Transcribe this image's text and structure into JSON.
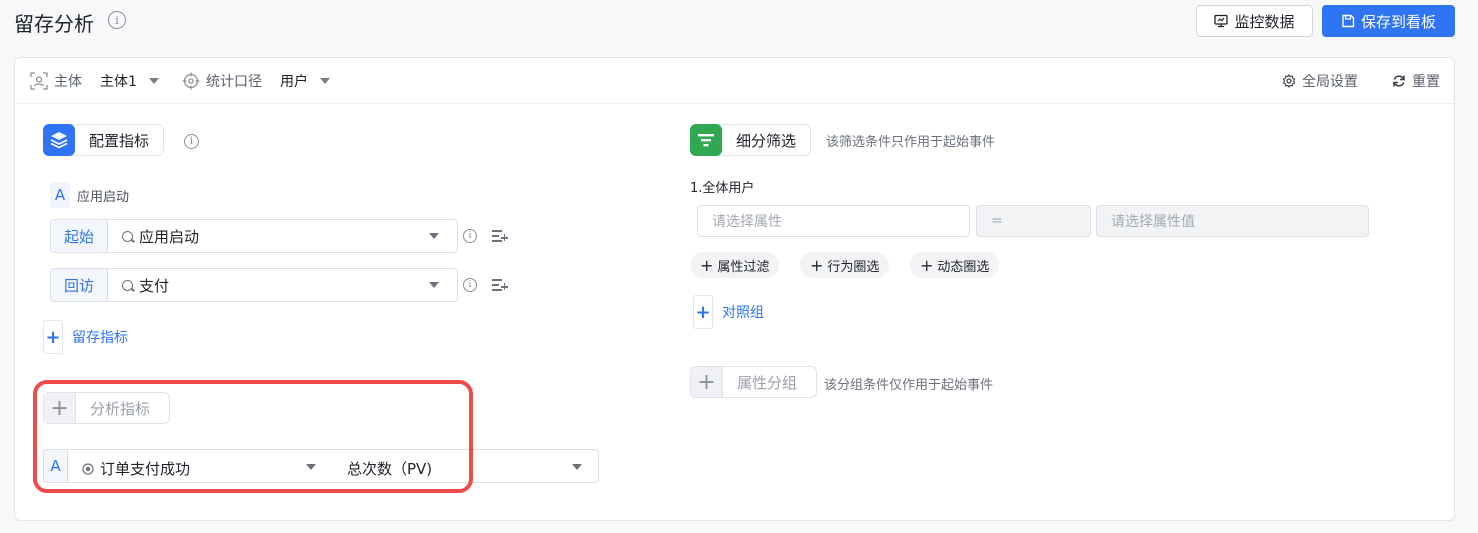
{
  "header": {
    "title": "留存分析",
    "monitor_label": "监控数据",
    "save_label": "保存到看板"
  },
  "toolbar": {
    "subject_label": "主体",
    "subject_value": "主体1",
    "scope_label": "统计口径",
    "scope_value": "用户",
    "global_settings": "全局设置",
    "reset": "重置"
  },
  "left": {
    "config_metric_label": "配置指标",
    "event_badge": "A",
    "event_name": "应用启动",
    "start": {
      "prefix": "起始",
      "value": "应用启动"
    },
    "revisit": {
      "prefix": "回访",
      "value": "支付"
    },
    "retention_metric_label": "留存指标",
    "analysis_metric_label": "分析指标",
    "metric": {
      "badge": "A",
      "event": "订单支付成功",
      "measure": "总次数（PV)"
    }
  },
  "right": {
    "filter_label": "细分筛选",
    "filter_note": "该筛选条件只作用于起始事件",
    "group_title": "1.全体用户",
    "attr_placeholder": "请选择属性",
    "operator": "=",
    "value_placeholder": "请选择属性值",
    "chips": [
      "属性过滤",
      "行为圈选",
      "动态圈选"
    ],
    "compare_group_label": "对照组",
    "attr_group_label": "属性分组",
    "attr_group_note": "该分组条件仅作用于起始事件"
  },
  "colors": {
    "accent": "#2e74f5",
    "highlight_border": "#ef4b4b",
    "filter_icon_bg": "#2fa84f"
  }
}
